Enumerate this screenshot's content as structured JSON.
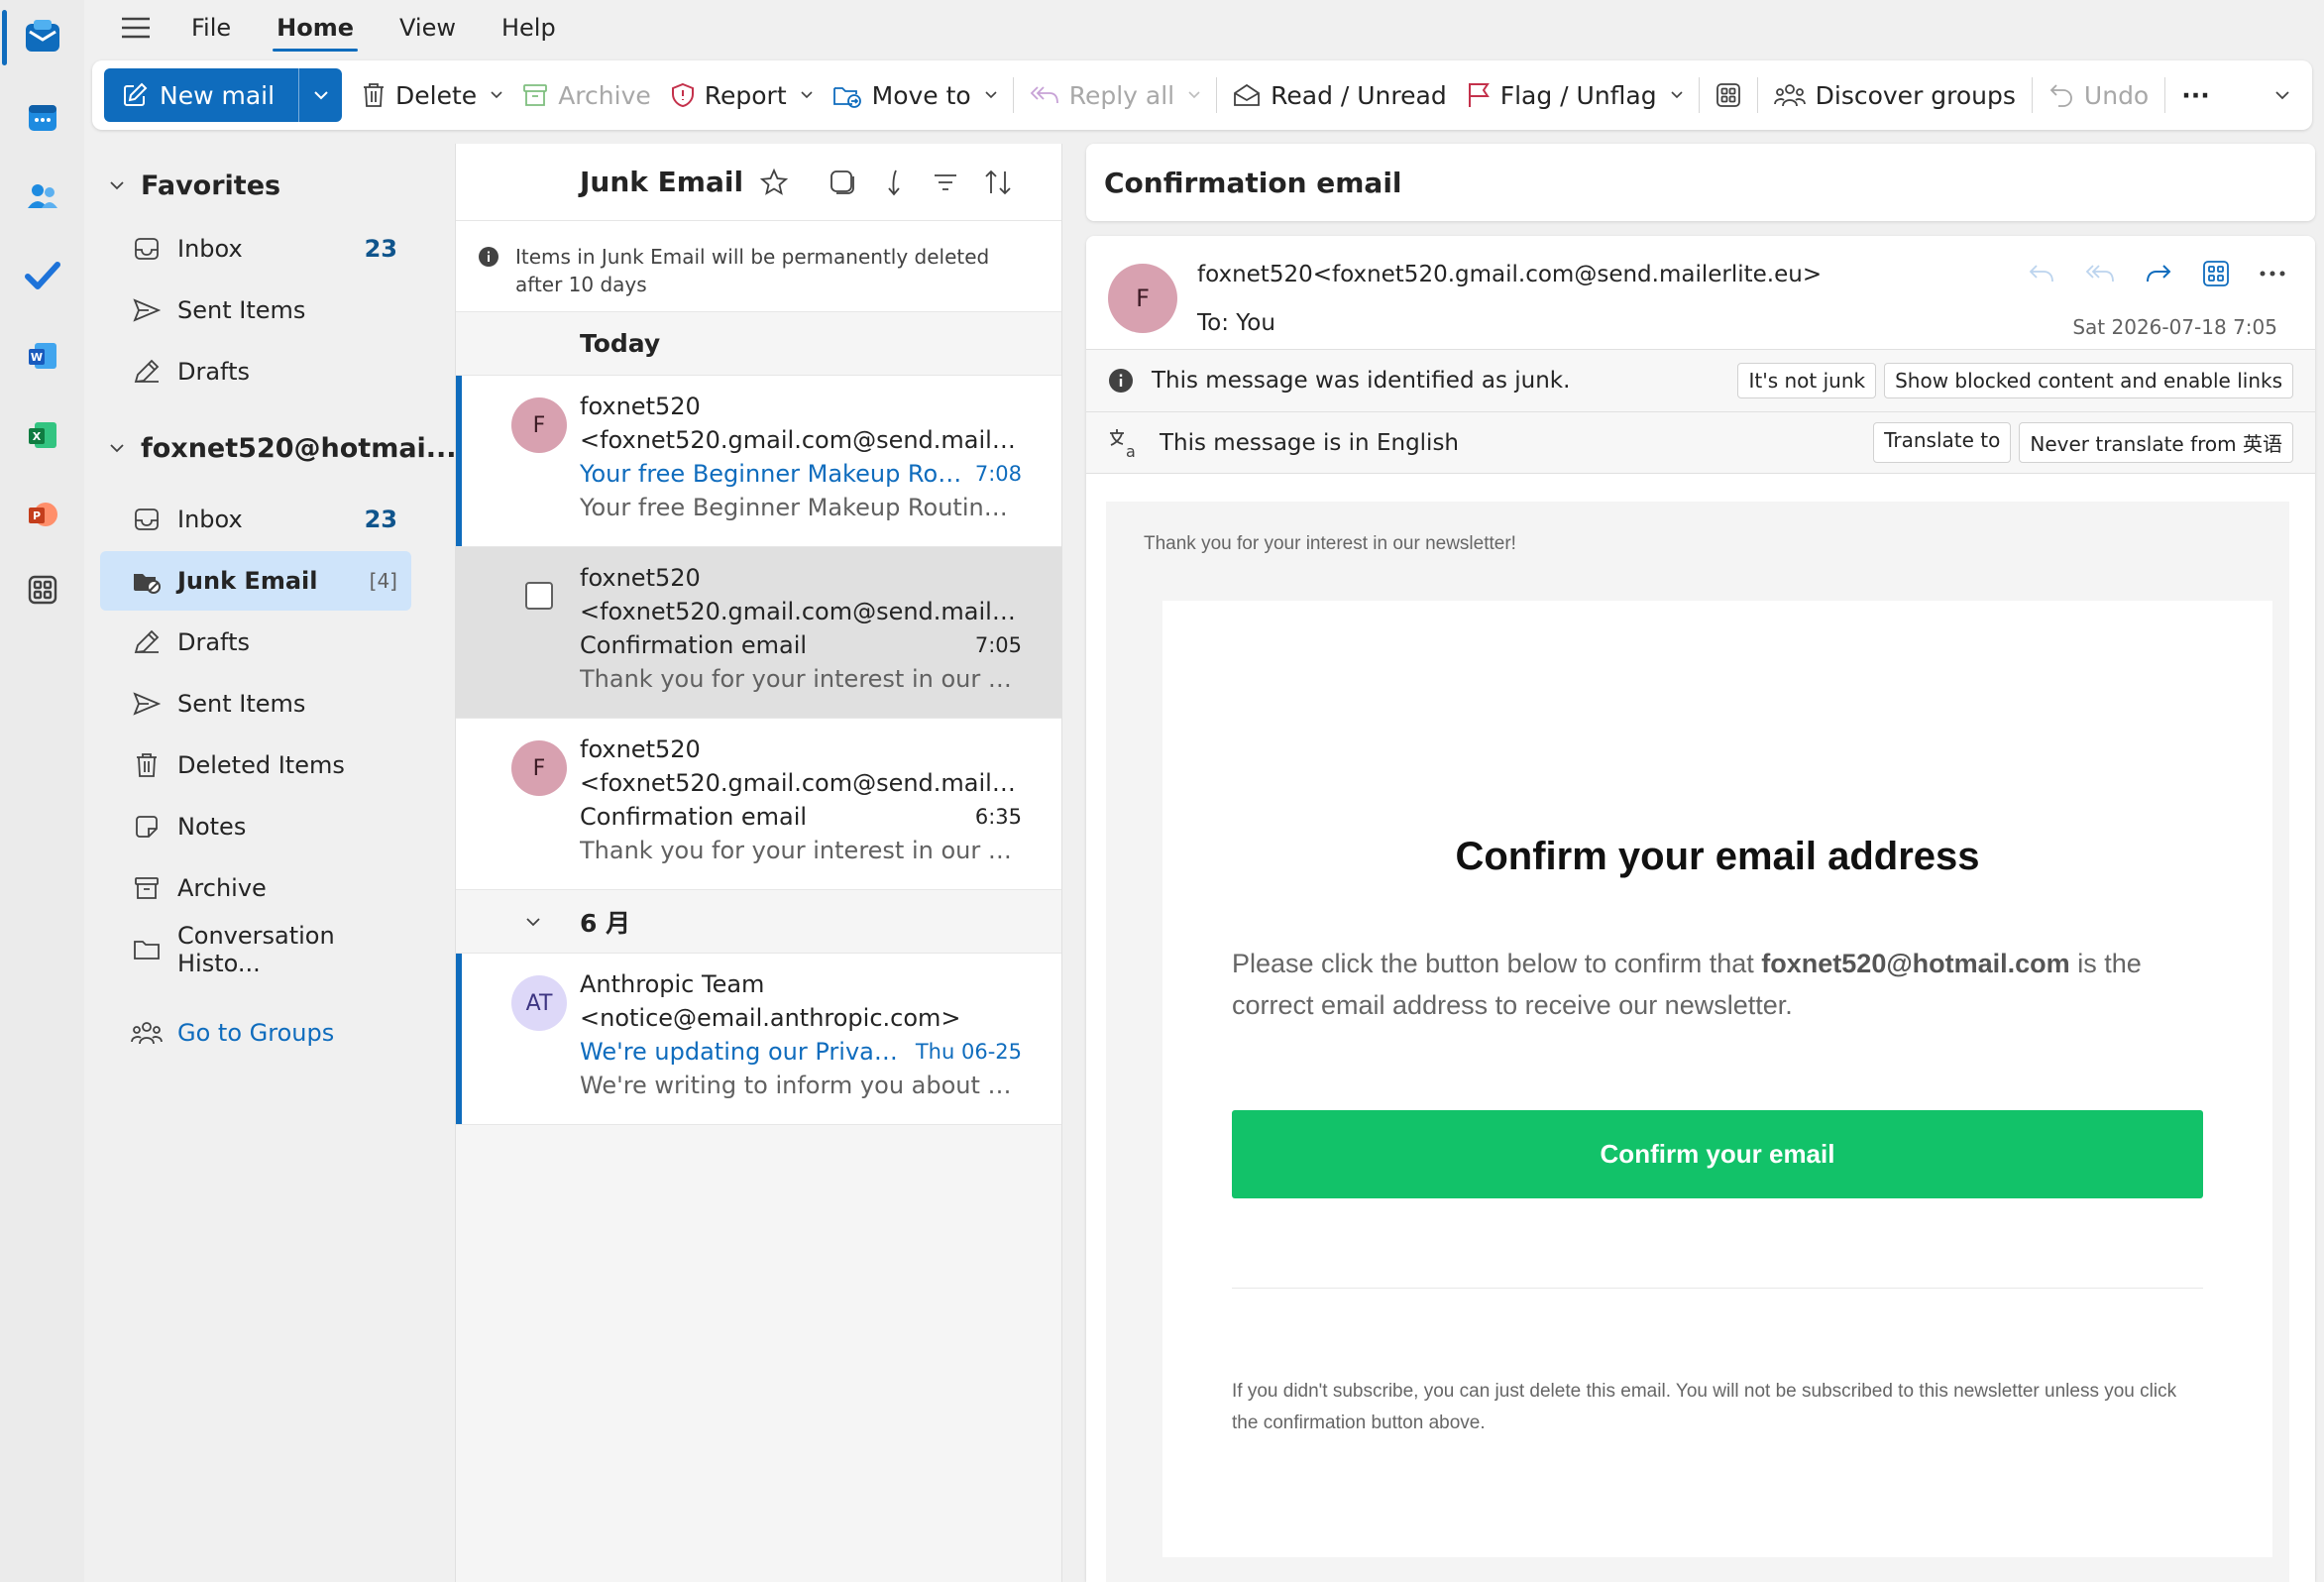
{
  "menu": {
    "file": "File",
    "home": "Home",
    "view": "View",
    "help": "Help"
  },
  "ribbon": {
    "new_mail": "New mail",
    "delete": "Delete",
    "archive": "Archive",
    "report": "Report",
    "move_to": "Move to",
    "reply_all": "Reply all",
    "read_unread": "Read / Unread",
    "flag_unflag": "Flag / Unflag",
    "discover_groups": "Discover groups",
    "undo": "Undo",
    "more": "···"
  },
  "folders": {
    "favorites_label": "Favorites",
    "favorites": [
      {
        "label": "Inbox",
        "count": "23",
        "icon": "inbox-icon"
      },
      {
        "label": "Sent Items",
        "count": "",
        "icon": "send-icon"
      },
      {
        "label": "Drafts",
        "count": "",
        "icon": "drafts-icon"
      }
    ],
    "account_label": "foxnet520@hotmai...",
    "account": [
      {
        "label": "Inbox",
        "count": "23",
        "icon": "inbox-icon"
      },
      {
        "label": "Junk Email",
        "count": "[4]",
        "icon": "junk-icon",
        "selected": true
      },
      {
        "label": "Drafts",
        "count": "",
        "icon": "drafts-icon"
      },
      {
        "label": "Sent Items",
        "count": "",
        "icon": "send-icon"
      },
      {
        "label": "Deleted Items",
        "count": "",
        "icon": "trash-icon"
      },
      {
        "label": "Notes",
        "count": "",
        "icon": "note-icon"
      },
      {
        "label": "Archive",
        "count": "",
        "icon": "archive-icon"
      },
      {
        "label": "Conversation Histo...",
        "count": "",
        "icon": "folder-icon"
      }
    ],
    "groups_link": "Go to Groups"
  },
  "list": {
    "title": "Junk Email",
    "notice": "Items in Junk Email will be permanently deleted after 10 days",
    "groups": [
      {
        "label": "Today",
        "messages": [
          {
            "avatar": "F",
            "from": "foxnet520",
            "email": "<foxnet520.gmail.com@send.mailerlit...",
            "subject": "Your free Beginner Makeup Rou...",
            "time": "7:08",
            "preview": "Your free Beginner Makeup Routine PD...",
            "unread": true
          },
          {
            "avatar": "F",
            "from": "foxnet520",
            "email": "<foxnet520.gmail.com@send.mailerlite...",
            "subject": "Confirmation email",
            "time": "7:05",
            "preview": "Thank you for your interest in our news...",
            "unread": false
          },
          {
            "avatar": "F",
            "from": "foxnet520",
            "email": "<foxnet520.gmail.com@send.mailerlite...",
            "subject": "Confirmation email",
            "time": "6:35",
            "preview": "Thank you for your interest in our news...",
            "unread": false
          }
        ]
      },
      {
        "label": "6 月",
        "messages": [
          {
            "avatar": "AT",
            "from": "Anthropic Team",
            "email": "<notice@email.anthropic.com>",
            "subject": "We're updating our Privac...",
            "time": "Thu 06-25",
            "preview": "We're writing to inform you about som...",
            "unread": true
          }
        ]
      }
    ]
  },
  "reader": {
    "subject": "Confirmation email",
    "avatar": "F",
    "from": "foxnet520<foxnet520.gmail.com@send.mailerlite.eu>",
    "to": "To:  You",
    "date": "Sat 2026-07-18 7:05",
    "junk_banner": "This message was identified as junk.",
    "not_junk_btn": "It's not junk",
    "show_blocked_btn": "Show blocked content and enable links",
    "lang_banner_prefix": "This message is in ",
    "lang_banner_lang": "English",
    "translate_btn": "Translate to",
    "never_translate_btn": "Never translate from 英语"
  },
  "email": {
    "thanks": "Thank you for your interest in our newsletter!",
    "title": "Confirm your email address",
    "body_pre": "Please click the button below to confirm that ",
    "body_email": "foxnet520@hotmail.com",
    "body_post": " is the correct email address to receive our newsletter.",
    "button": "Confirm your email",
    "footer": "If you didn't subscribe, you can just delete this email. You will not be subscribed to this newsletter unless you click the confirmation button above."
  },
  "colors": {
    "accent": "#0f6cbd",
    "confirm_button": "#12c269",
    "avatar_f": "#d8a1b0",
    "avatar_at": "#ddd8f8"
  }
}
